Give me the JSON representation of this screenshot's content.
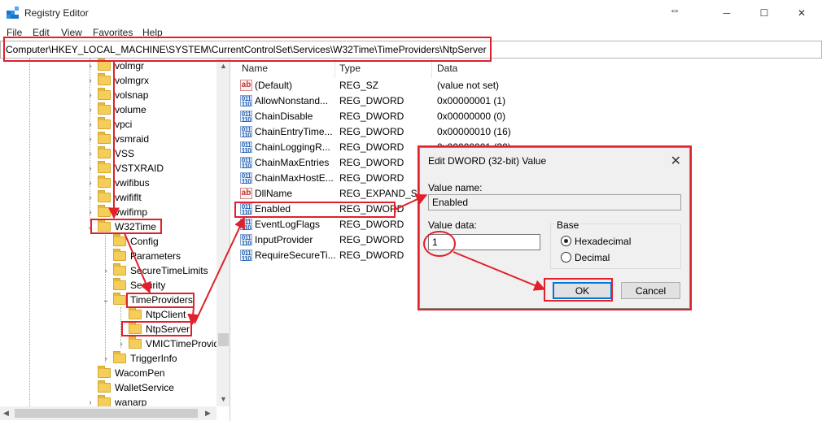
{
  "window": {
    "title": "Registry Editor",
    "resize_glyph": "⇔",
    "minimize_glyph": "─",
    "maximize_glyph": "☐",
    "close_glyph": "✕",
    "app_icon": "registry-icon"
  },
  "menu": {
    "items": [
      "File",
      "Edit",
      "View",
      "Favorites",
      "Help"
    ]
  },
  "address": {
    "path": "Computer\\HKEY_LOCAL_MACHINE\\SYSTEM\\CurrentControlSet\\Services\\W32Time\\TimeProviders\\NtpServer"
  },
  "tree": {
    "items": [
      {
        "label": "volmgr",
        "expander": "›"
      },
      {
        "label": "volmgrx",
        "expander": "›"
      },
      {
        "label": "volsnap",
        "expander": "›"
      },
      {
        "label": "volume",
        "expander": "›"
      },
      {
        "label": "vpci",
        "expander": "›"
      },
      {
        "label": "vsmraid",
        "expander": "›"
      },
      {
        "label": "VSS",
        "expander": "›"
      },
      {
        "label": "VSTXRAID",
        "expander": "›"
      },
      {
        "label": "vwifibus",
        "expander": "›"
      },
      {
        "label": "vwififlt",
        "expander": "›"
      },
      {
        "label": "vwifimp",
        "expander": "›"
      },
      {
        "label": "W32Time",
        "expander": "⌄"
      },
      {
        "label": "Config",
        "expander": ""
      },
      {
        "label": "Parameters",
        "expander": ""
      },
      {
        "label": "SecureTimeLimits",
        "expander": "›"
      },
      {
        "label": "Security",
        "expander": ""
      },
      {
        "label": "TimeProviders",
        "expander": "⌄"
      },
      {
        "label": "NtpClient",
        "expander": ""
      },
      {
        "label": "NtpServer",
        "expander": ""
      },
      {
        "label": "VMICTimeProvider",
        "expander": "›"
      },
      {
        "label": "TriggerInfo",
        "expander": "›"
      },
      {
        "label": "WacomPen",
        "expander": ""
      },
      {
        "label": "WalletService",
        "expander": ""
      },
      {
        "label": "wanarp",
        "expander": "›"
      }
    ],
    "scroll_up": "▲",
    "scroll_down": "▼",
    "scroll_left": "◀",
    "scroll_right": "▶"
  },
  "list": {
    "columns": [
      "Name",
      "Type",
      "Data"
    ],
    "rows": [
      {
        "icon": "ab",
        "name": "(Default)",
        "type": "REG_SZ",
        "data": "(value not set)"
      },
      {
        "icon": "dw",
        "name": "AllowNonstand...",
        "type": "REG_DWORD",
        "data": "0x00000001 (1)"
      },
      {
        "icon": "dw",
        "name": "ChainDisable",
        "type": "REG_DWORD",
        "data": "0x00000000 (0)"
      },
      {
        "icon": "dw",
        "name": "ChainEntryTime...",
        "type": "REG_DWORD",
        "data": "0x00000010 (16)"
      },
      {
        "icon": "dw",
        "name": "ChainLoggingR...",
        "type": "REG_DWORD",
        "data": "0x00000001 (30)"
      },
      {
        "icon": "dw",
        "name": "ChainMaxEntries",
        "type": "REG_DWORD",
        "data": ""
      },
      {
        "icon": "dw",
        "name": "ChainMaxHostE...",
        "type": "REG_DWORD",
        "data": ""
      },
      {
        "icon": "ab",
        "name": "DllName",
        "type": "REG_EXPAND_SZ",
        "data": ""
      },
      {
        "icon": "dw",
        "name": "Enabled",
        "type": "REG_DWORD",
        "data": ""
      },
      {
        "icon": "dw",
        "name": "EventLogFlags",
        "type": "REG_DWORD",
        "data": ""
      },
      {
        "icon": "dw",
        "name": "InputProvider",
        "type": "REG_DWORD",
        "data": ""
      },
      {
        "icon": "dw",
        "name": "RequireSecureTi...",
        "type": "REG_DWORD",
        "data": ""
      }
    ]
  },
  "dialog": {
    "title": "Edit DWORD (32-bit) Value",
    "close_glyph": "✕",
    "value_name_label": "Value name:",
    "value_name": "Enabled",
    "value_data_label": "Value data:",
    "value_data": "1",
    "base_label": "Base",
    "radio_hex": "Hexadecimal",
    "radio_dec": "Decimal",
    "selected_base": "Hexadecimal",
    "ok": "OK",
    "cancel": "Cancel"
  },
  "colors": {
    "annotation": "#e0202a",
    "folder": "#f5cd5a",
    "accent": "#0078d7"
  }
}
